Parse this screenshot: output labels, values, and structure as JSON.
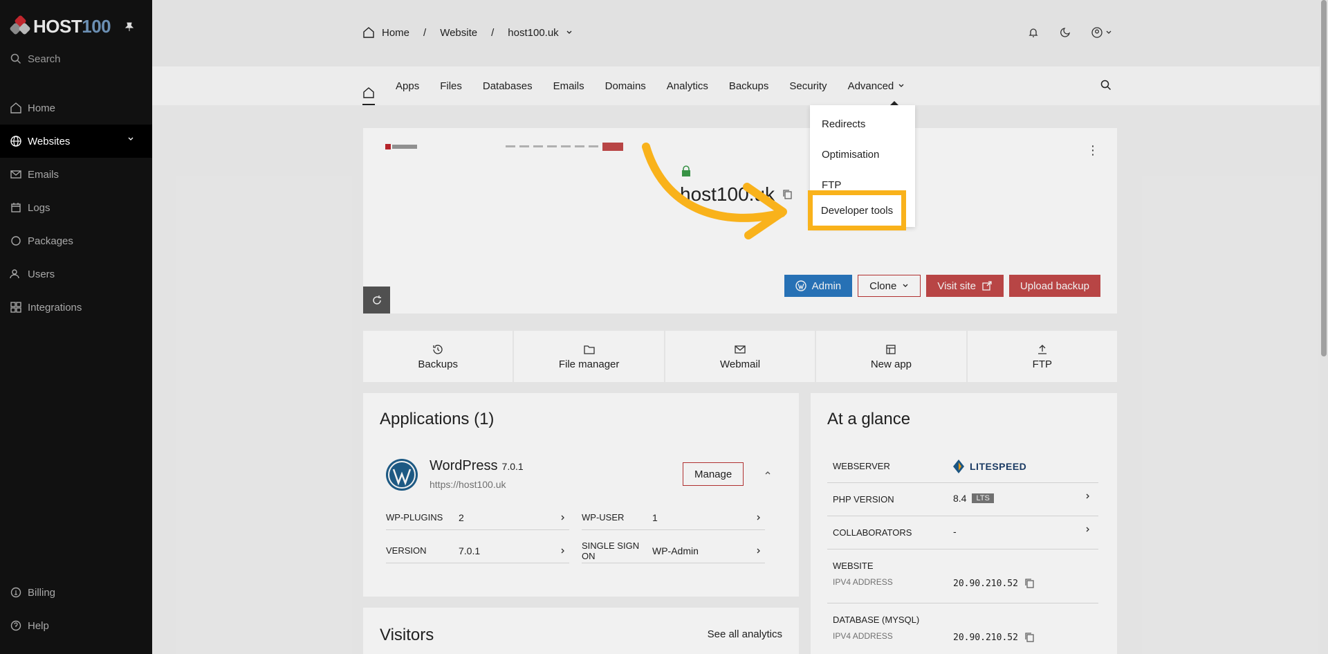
{
  "brand": {
    "logo_a": "HOST",
    "logo_b": "100"
  },
  "sidebar": {
    "search_placeholder": "Search",
    "items": [
      {
        "label": "Home",
        "icon": "home-icon"
      },
      {
        "label": "Websites",
        "icon": "globe-icon",
        "active": true
      },
      {
        "label": "Emails",
        "icon": "mail-icon"
      },
      {
        "label": "Logs",
        "icon": "calendar-icon"
      },
      {
        "label": "Packages",
        "icon": "circle-icon"
      },
      {
        "label": "Users",
        "icon": "users-icon"
      },
      {
        "label": "Integrations",
        "icon": "grid-icon"
      }
    ],
    "bottom": [
      {
        "label": "Billing",
        "icon": "coin-icon"
      },
      {
        "label": "Help",
        "icon": "help-icon"
      }
    ]
  },
  "breadcrumb": {
    "home": "Home",
    "section": "Website",
    "site": "host100.uk"
  },
  "tabs": [
    "Apps",
    "Files",
    "Databases",
    "Emails",
    "Domains",
    "Analytics",
    "Backups",
    "Security",
    "Advanced"
  ],
  "dropdown": {
    "items": [
      "Redirects",
      "Optimisation",
      "FTP"
    ],
    "highlighted": "Developer tools"
  },
  "site_card": {
    "title": "host100.uk",
    "buttons": {
      "admin": "Admin",
      "clone": "Clone",
      "visit": "Visit site",
      "upload": "Upload backup"
    }
  },
  "quick_actions": [
    "Backups",
    "File manager",
    "Webmail",
    "New app",
    "FTP"
  ],
  "applications": {
    "heading": "Applications (1)",
    "app_name": "WordPress",
    "app_version": "7.0.1",
    "app_url": "https://host100.uk",
    "manage": "Manage",
    "rows": [
      {
        "k": "WP-PLUGINS",
        "v": "2"
      },
      {
        "k": "WP-USER",
        "v": "1"
      },
      {
        "k": "VERSION",
        "v": "7.0.1"
      },
      {
        "k": "SINGLE SIGN ON",
        "v": "WP-Admin"
      }
    ]
  },
  "glance": {
    "heading": "At a glance",
    "webserver_k": "WEBSERVER",
    "webserver_v": "LITESPEED",
    "php_k": "PHP VERSION",
    "php_v": "8.4",
    "php_badge": "LTS",
    "collab_k": "COLLABORATORS",
    "collab_v": "-",
    "website_k": "WEBSITE",
    "website_sub": "IPV4 ADDRESS",
    "website_ip": "20.90.210.52",
    "db_k": "DATABASE (MYSQL)",
    "db_sub": "IPV4 ADDRESS",
    "db_ip": "20.90.210.52"
  },
  "visitors": {
    "heading": "Visitors",
    "link": "See all analytics"
  },
  "colors": {
    "accent": "#f9b21b",
    "danger": "#c34a4a",
    "wp_blue": "#2a78c0",
    "sidebar": "#111111"
  }
}
